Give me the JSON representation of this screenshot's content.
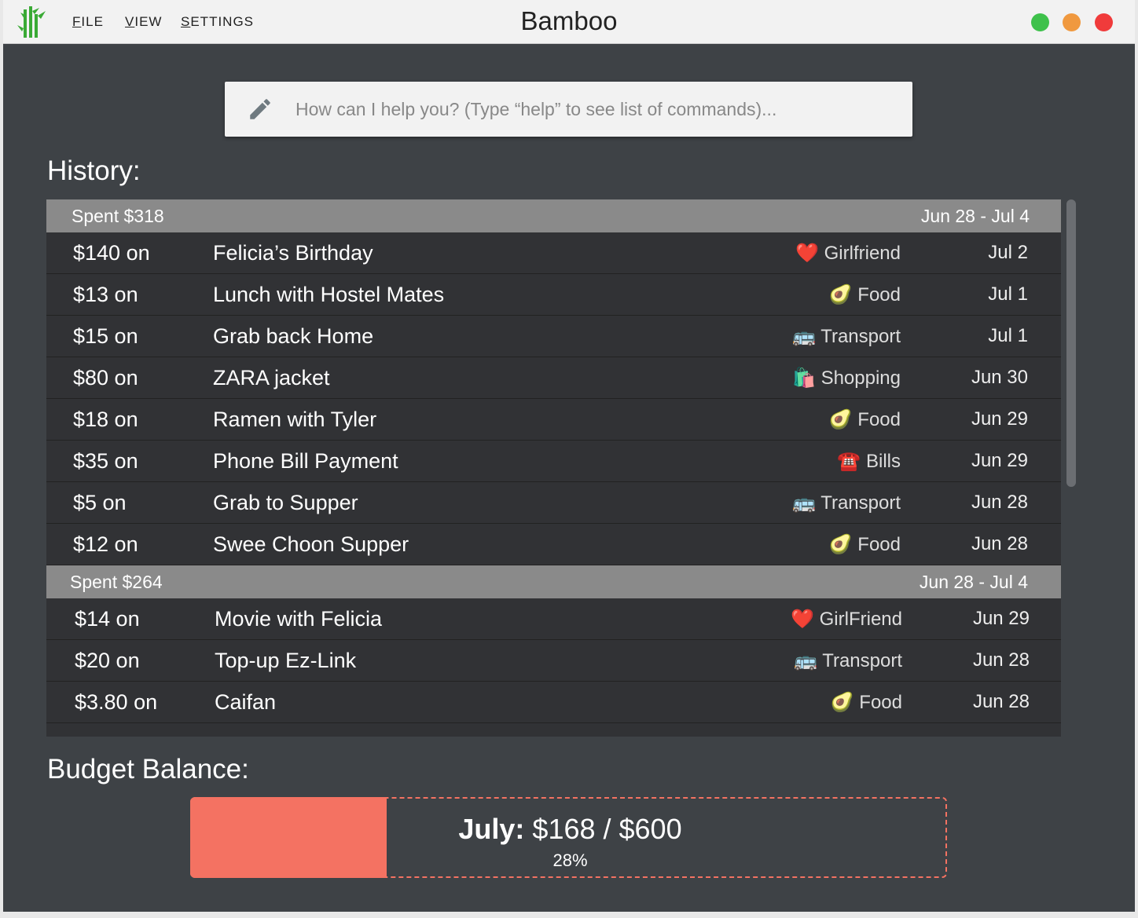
{
  "app": {
    "title": "Bamboo",
    "menu": [
      {
        "key": "F",
        "rest": "ILE"
      },
      {
        "key": "V",
        "rest": "IEW"
      },
      {
        "key": "S",
        "rest": "ETTINGS"
      }
    ],
    "window_controls": {
      "green": "#3ec14b",
      "orange": "#f0993f",
      "red": "#f03b3b"
    }
  },
  "command": {
    "placeholder": "How can I help you? (Type “help” to see list of commands)...",
    "value": ""
  },
  "history": {
    "title": "History:",
    "groups": [
      {
        "spent": "Spent $318",
        "range": "Jun 28 - Jul 4",
        "items": [
          {
            "amount": "$140 on",
            "desc": "Felicia’s Birthday",
            "icon": "❤️",
            "category": "Girlfriend",
            "date": "Jul 2"
          },
          {
            "amount": "$13 on",
            "desc": "Lunch with Hostel Mates",
            "icon": "🥑",
            "category": "Food",
            "date": "Jul 1"
          },
          {
            "amount": "$15 on",
            "desc": "Grab back Home",
            "icon": "🚌",
            "category": "Transport",
            "date": "Jul 1"
          },
          {
            "amount": "$80 on",
            "desc": "ZARA jacket",
            "icon": "🛍️",
            "category": "Shopping",
            "date": "Jun 30"
          },
          {
            "amount": "$18 on",
            "desc": "Ramen with Tyler",
            "icon": "🥑",
            "category": "Food",
            "date": "Jun 29"
          },
          {
            "amount": "$35 on",
            "desc": "Phone Bill Payment",
            "icon": "☎️",
            "category": "Bills",
            "date": "Jun 29"
          },
          {
            "amount": "$5 on",
            "desc": "Grab to Supper",
            "icon": "🚌",
            "category": "Transport",
            "date": "Jun 28"
          },
          {
            "amount": "$12 on",
            "desc": "Swee Choon Supper",
            "icon": "🥑",
            "category": "Food",
            "date": "Jun 28"
          }
        ]
      },
      {
        "spent": "Spent $264",
        "range": "Jun 28 - Jul 4",
        "items": [
          {
            "amount": "$14 on",
            "desc": "Movie with Felicia",
            "icon": "❤️",
            "category": "GirlFriend",
            "date": "Jun 29"
          },
          {
            "amount": "$20 on",
            "desc": "Top-up Ez-Link",
            "icon": "🚌",
            "category": "Transport",
            "date": "Jun 28"
          },
          {
            "amount": "$3.80 on",
            "desc": "Caifan",
            "icon": "🥑",
            "category": "Food",
            "date": "Jun 28"
          }
        ]
      }
    ]
  },
  "budget": {
    "title": "Budget Balance:",
    "month": "July:",
    "amount": "$168 / $600",
    "percent_label": "28%",
    "fraction": 0.26,
    "color": "#f47262"
  }
}
